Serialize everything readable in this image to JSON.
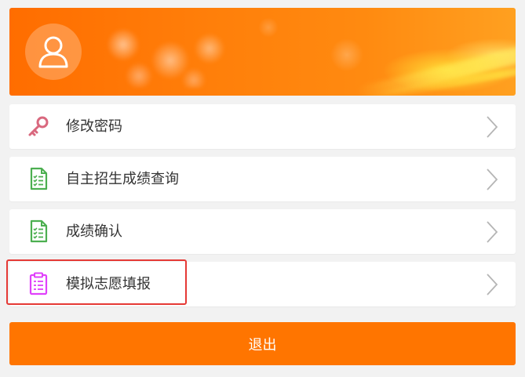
{
  "colors": {
    "accent": "#ff7500",
    "banner_start": "#ff6d00",
    "key_icon": "#d9687e",
    "doc_icon": "#4caf50",
    "clipboard_icon": "#e040fb",
    "highlight_border": "#e53935"
  },
  "header": {
    "avatar_icon": "user-icon"
  },
  "menu": {
    "items": [
      {
        "label": "修改密码",
        "icon": "key-icon"
      },
      {
        "label": "自主招生成绩查询",
        "icon": "document-list-icon"
      },
      {
        "label": "成绩确认",
        "icon": "document-list-icon"
      },
      {
        "label": "模拟志愿填报",
        "icon": "clipboard-icon",
        "highlighted": true
      }
    ]
  },
  "logout": {
    "label": "退出"
  }
}
